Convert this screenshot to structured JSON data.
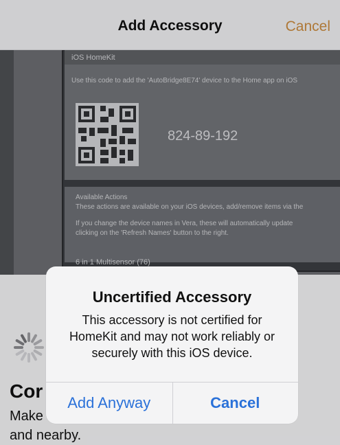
{
  "nav": {
    "title": "Add Accessory",
    "cancel_label": "Cancel"
  },
  "camera": {
    "header": "iOS HomeKit",
    "instruction": "Use this code to add the 'AutoBridge8E74' device to the Home app on iOS",
    "setup_code": "824-89-192",
    "available_actions": "Available Actions",
    "actions_desc": "These actions are available on your iOS devices, add/remove items via the",
    "rename_line1": "If you change the device names in Vera, these will automatically update",
    "rename_line2": "clicking on the 'Refresh Names' button to the right.",
    "device_item": "6 in 1 Multisensor (76)"
  },
  "content": {
    "title": "Cor",
    "description": "Make",
    "description_line2": "and nearby."
  },
  "alert": {
    "title": "Uncertified Accessory",
    "message": "This accessory is not certified for HomeKit and may not work reliably or securely with this iOS device.",
    "add_anyway_label": "Add Anyway",
    "cancel_label": "Cancel"
  },
  "colors": {
    "nav_accent": "#c7893f",
    "alert_button": "#2a71d9"
  },
  "icons": {
    "spinner": "activity-spinner-icon",
    "qr": "qr-code-icon"
  }
}
